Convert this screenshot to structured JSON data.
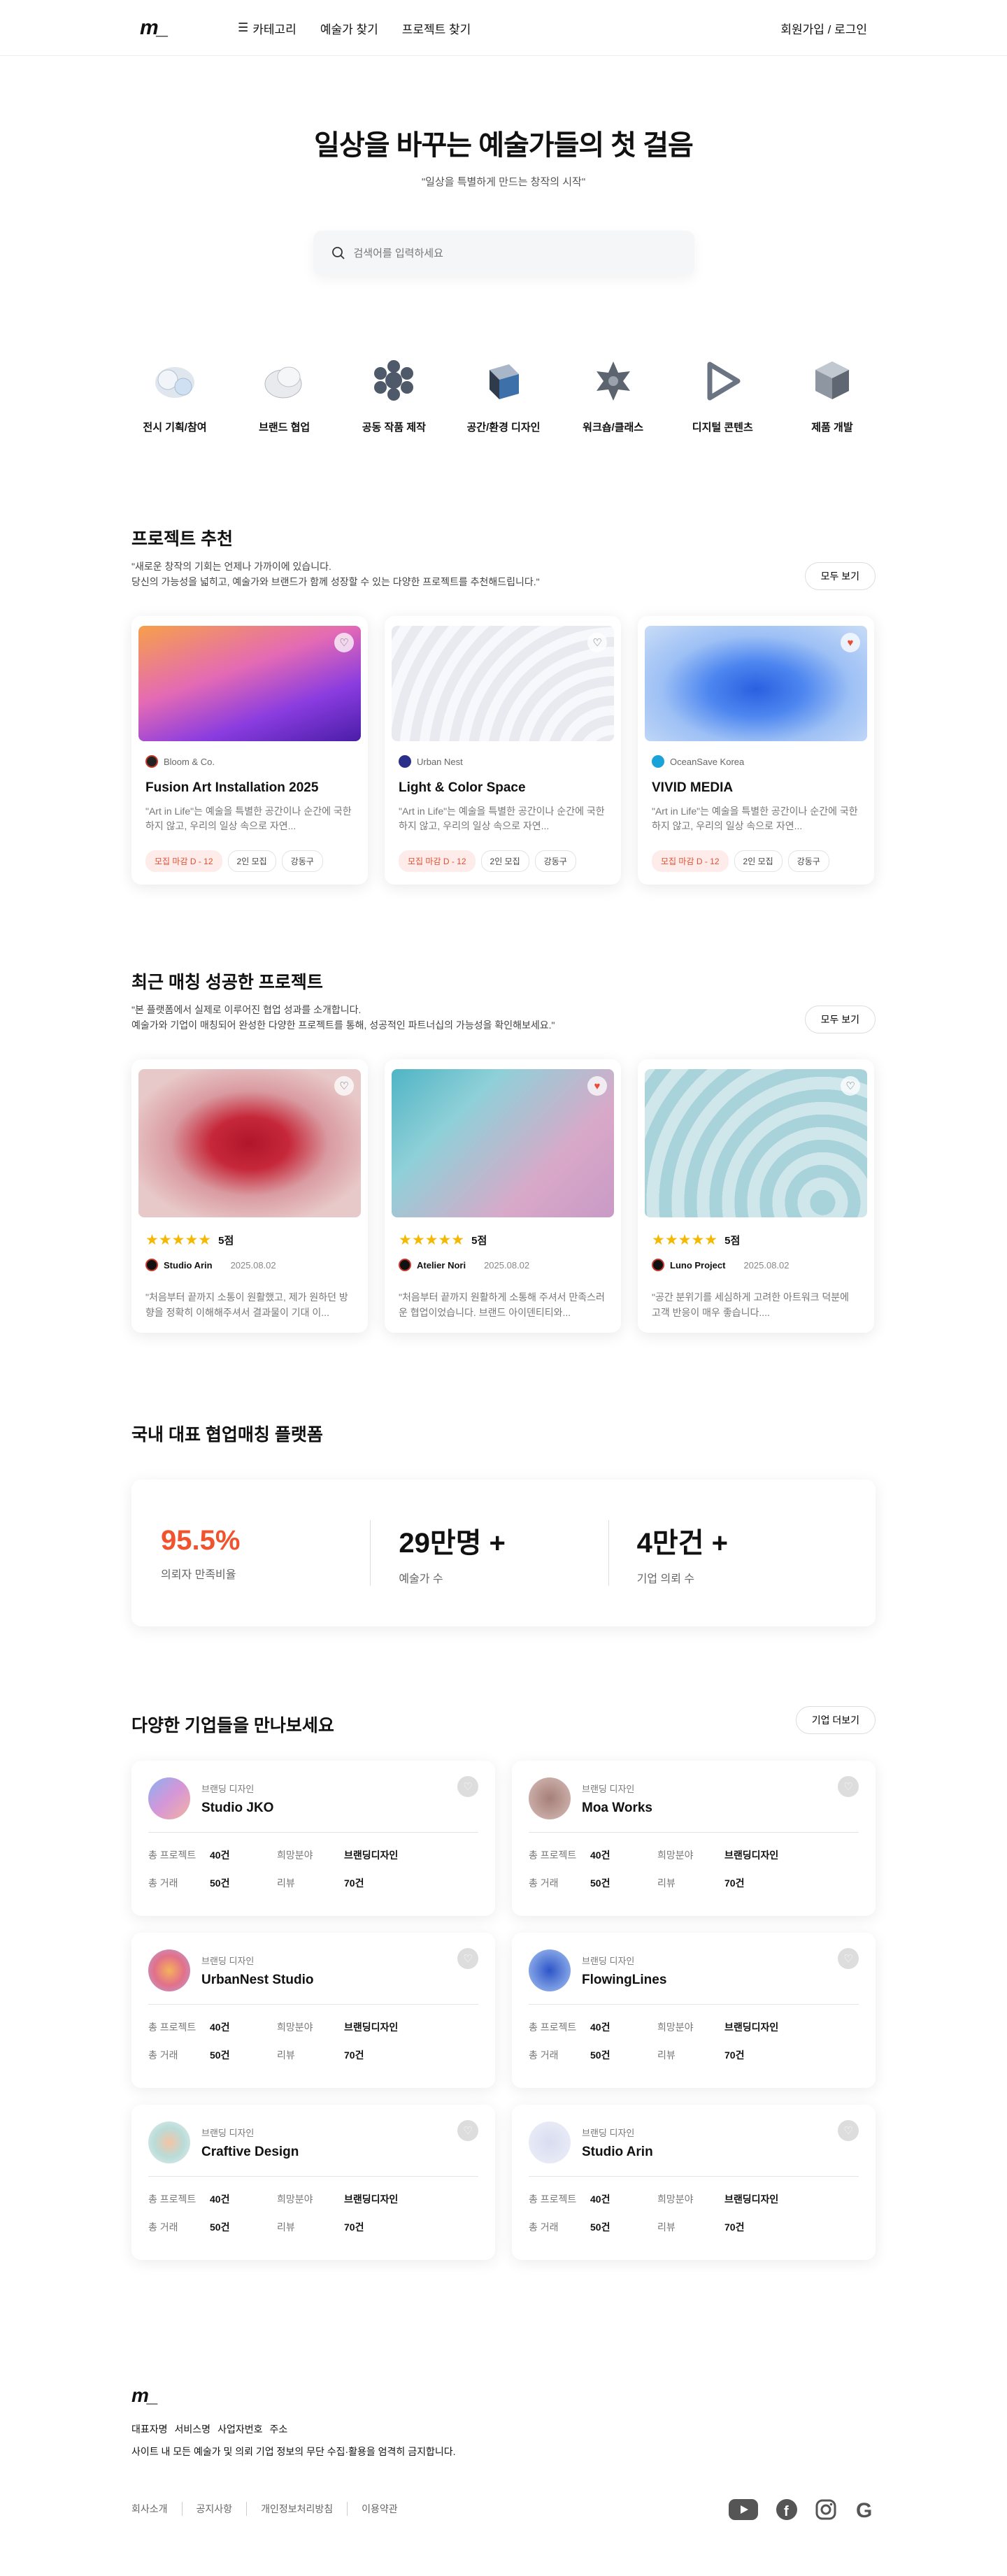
{
  "header": {
    "logo": "m_",
    "nav": [
      {
        "label": "카테고리",
        "icon": "menu-icon"
      },
      {
        "label": "예술가 찾기"
      },
      {
        "label": "프로젝트 찾기"
      }
    ],
    "login": "회원가입 / 로그인"
  },
  "hero": {
    "title": "일상을 바꾸는 예술가들의 첫 걸음",
    "subtitle": "\"일상을 특별하게 만드는 창작의 시작\"",
    "search_placeholder": "검색어를 입력하세요"
  },
  "categories": [
    {
      "label": "전시 기획/참여"
    },
    {
      "label": "브랜드 협업"
    },
    {
      "label": "공동 작품 제작"
    },
    {
      "label": "공간/환경 디자인"
    },
    {
      "label": "워크숍/클래스"
    },
    {
      "label": "디지털 콘텐츠"
    },
    {
      "label": "제품 개발"
    }
  ],
  "recommend": {
    "title": "프로젝트 추천",
    "desc1": "\"새로운 창작의 기회는 언제나 가까이에 있습니다.",
    "desc2": "당신의 가능성을 넓히고, 예술가와 브랜드가 함께 성장할 수 있는 다양한 프로젝트를 추천해드립니다.\"",
    "more": "모두 보기",
    "cards": [
      {
        "org": "Bloom & Co.",
        "title": "Fusion Art Installation 2025",
        "text": "\"Art in Life\"는 예술을 특별한 공간이나 순간에 국한하지 않고, 우리의 일상 속으로 자연...",
        "tags": [
          "모집 마감 D - 12",
          "2인 모집",
          "강동구"
        ],
        "liked": false
      },
      {
        "org": "Urban Nest",
        "title": "Light & Color Space",
        "text": "\"Art in Life\"는 예술을 특별한 공간이나 순간에 국한하지 않고, 우리의 일상 속으로 자연...",
        "tags": [
          "모집 마감 D - 12",
          "2인 모집",
          "강동구"
        ],
        "liked": false
      },
      {
        "org": "OceanSave Korea",
        "title": "VIVID MEDIA",
        "text": "\"Art in Life\"는 예술을 특별한 공간이나 순간에 국한하지 않고, 우리의 일상 속으로 자연...",
        "tags": [
          "모집 마감 D - 12",
          "2인 모집",
          "강동구"
        ],
        "liked": true
      }
    ]
  },
  "matched": {
    "title": "최근 매칭 성공한 프로젝트",
    "desc1": "\"본 플랫폼에서 실제로 이루어진 협업 성과를 소개합니다.",
    "desc2": "예술가와 기업이 매칭되어 완성한 다양한 프로젝트를 통해, 성공적인 파트너십의 가능성을 확인해보세요.\"",
    "more": "모두 보기",
    "cards": [
      {
        "score": "5점",
        "name": "Studio Arin",
        "date": "2025.08.02",
        "quote": "\"처음부터 끝까지 소통이 원활했고, 제가 원하던 방향을 정확히 이해해주셔서 결과물이 기대 이...",
        "liked": false
      },
      {
        "score": "5점",
        "name": "Atelier Nori",
        "date": "2025.08.02",
        "quote": "\"처음부터 끝까지 원활하게 소통해 주셔서 만족스러운 협업이었습니다. 브랜드 아이덴티티와...",
        "liked": true
      },
      {
        "score": "5점",
        "name": "Luno Project",
        "date": "2025.08.02",
        "quote": "\"공간 분위기를 세심하게 고려한 아트워크 덕분에 고객 반응이 매우 좋습니다....",
        "liked": false
      }
    ]
  },
  "stats": {
    "title": "국내 대표 협업매칭 플랫폼",
    "items": [
      {
        "value": "95.5%",
        "label": "의뢰자 만족비율"
      },
      {
        "value": "29만명 +",
        "label": "예술가 수"
      },
      {
        "value": "4만건 +",
        "label": "기업 의뢰 수"
      }
    ]
  },
  "companies": {
    "title": "다양한 기업들을 만나보세요",
    "more": "기업 더보기",
    "labels": {
      "projects": "총 프로젝트",
      "field": "희망분야",
      "deals": "총 거래",
      "reviews": "리뷰"
    },
    "items": [
      {
        "category": "브랜딩 디자인",
        "name": "Studio JKO",
        "projects": "40건",
        "field": "브랜딩디자인",
        "deals": "50건",
        "reviews": "70건"
      },
      {
        "category": "브랜딩 디자인",
        "name": "Moa Works",
        "projects": "40건",
        "field": "브랜딩디자인",
        "deals": "50건",
        "reviews": "70건"
      },
      {
        "category": "브랜딩 디자인",
        "name": "UrbanNest Studio",
        "projects": "40건",
        "field": "브랜딩디자인",
        "deals": "50건",
        "reviews": "70건"
      },
      {
        "category": "브랜딩 디자인",
        "name": "FlowingLines",
        "projects": "40건",
        "field": "브랜딩디자인",
        "deals": "50건",
        "reviews": "70건"
      },
      {
        "category": "브랜딩 디자인",
        "name": "Craftive Design",
        "projects": "40건",
        "field": "브랜딩디자인",
        "deals": "50건",
        "reviews": "70건"
      },
      {
        "category": "브랜딩 디자인",
        "name": "Studio Arin",
        "projects": "40건",
        "field": "브랜딩디자인",
        "deals": "50건",
        "reviews": "70건"
      }
    ]
  },
  "footer": {
    "logo": "m_",
    "info": [
      "대표자명",
      "서비스명",
      "사업자번호",
      "주소"
    ],
    "notice": "사이트 내 모든 예술가 및 의뢰 기업 정보의 무단 수집·활용을 엄격히 금지합니다.",
    "links": [
      "회사소개",
      "공지사항",
      "개인정보처리방침",
      "이용약관"
    ]
  }
}
